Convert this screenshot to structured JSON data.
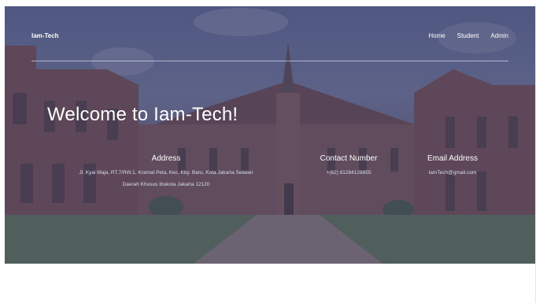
{
  "navbar": {
    "brand": "Iam-Tech",
    "links": [
      "Home",
      "Student",
      "Admin"
    ]
  },
  "hero": {
    "heading": "Welcome to Iam-Tech!",
    "address": {
      "title": "Address",
      "line1": "Jl. Kyai Maja, RT.7/RW.1, Kramat Pela, Kec. Kby. Baru, Kota Jakarta Selatan",
      "line2": "Daerah Khusus Ibukota Jakarta 12120"
    },
    "contact": {
      "title": "Contact Number",
      "value": "+(62) 81284128855"
    },
    "email": {
      "title": "Email Address",
      "value": "IamTech@gmail.com"
    }
  },
  "colors": {
    "overlay": "#46466e",
    "text": "#ffffff"
  }
}
